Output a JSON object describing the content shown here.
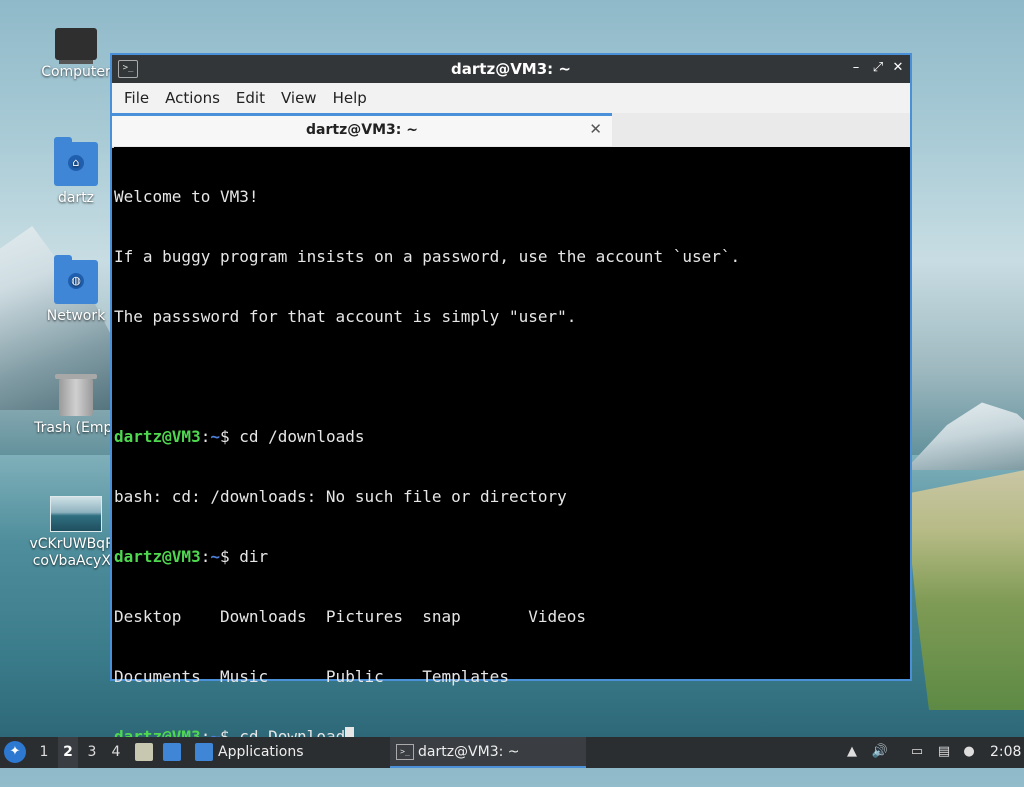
{
  "desktop": {
    "icons": [
      {
        "label": "Computer",
        "icon": "computer-icon"
      },
      {
        "label": "dartz",
        "icon": "home-folder-icon"
      },
      {
        "label": "Network",
        "icon": "network-folder-icon"
      },
      {
        "label": "Trash (Empt",
        "icon": "trash-icon"
      },
      {
        "label": "vCKrUWBqRc",
        "label2": "coVbaAcyX.j",
        "icon": "image-file-icon"
      }
    ]
  },
  "window": {
    "title": "dartz@VM3: ~",
    "menu": [
      "File",
      "Actions",
      "Edit",
      "View",
      "Help"
    ],
    "tab_label": "dartz@VM3: ~",
    "controls": {
      "minimize": "–",
      "maximize": "⤢",
      "close": "✕"
    }
  },
  "terminal": {
    "welcome1": "Welcome to VM3!",
    "welcome2": "If a buggy program insists on a password, use the account `user`.",
    "welcome3": "The passsword for that account is simply \"user\".",
    "prompt_user": "dartz@VM3",
    "prompt_sep": ":",
    "prompt_path": "~",
    "prompt_end": "$ ",
    "cmd1": "cd /downloads",
    "out1": "bash: cd: /downloads: No such file or directory",
    "cmd2": "dir",
    "dir_row1": "Desktop    Downloads  Pictures  snap       Videos",
    "dir_row2": "Documents  Music      Public    Templates",
    "cmd3": "cd Download"
  },
  "taskbar": {
    "workspaces": [
      "1",
      "2",
      "3",
      "4"
    ],
    "active_workspace": "2",
    "applications_label": "Applications",
    "task_label": "dartz@VM3: ~",
    "clock": "2:08"
  },
  "colors": {
    "accent": "#4a90d9",
    "prompt_user": "#4fd84f",
    "prompt_path": "#4f7fd8"
  }
}
